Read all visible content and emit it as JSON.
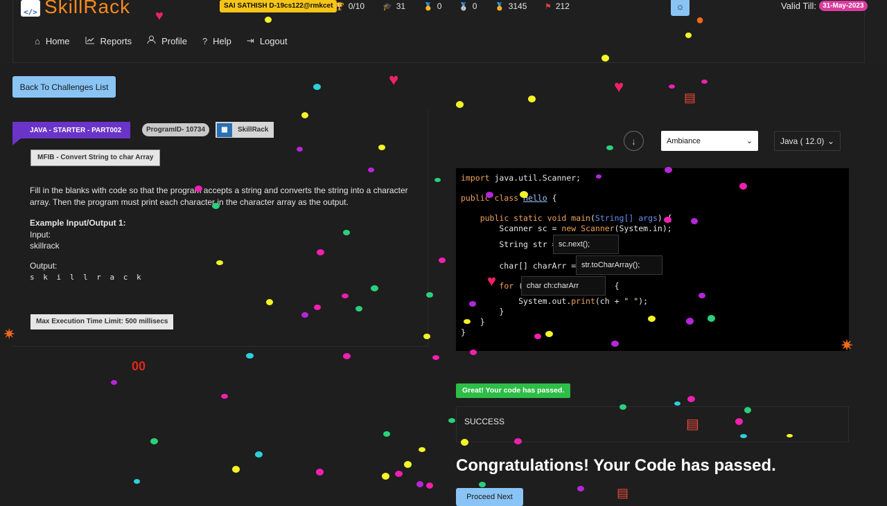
{
  "header": {
    "logo_text": "SkillRack",
    "logo_box": "</>",
    "user": "SAI SATHISH D-19cs122@rmkcet",
    "stats": [
      {
        "icon": "trophy-icon",
        "glyph": "🏆",
        "value": "0/10"
      },
      {
        "icon": "graduation-cap-icon",
        "glyph": "🎓",
        "value": "31"
      },
      {
        "icon": "gold-medal-icon",
        "glyph": "🥇",
        "value": "0"
      },
      {
        "icon": "silver-medal-icon",
        "glyph": "🥈",
        "value": "0"
      },
      {
        "icon": "red-medal-icon",
        "glyph": "🏅",
        "value": "3145"
      },
      {
        "icon": "flag-icon",
        "glyph": "⚑",
        "value": "212"
      }
    ],
    "valid_till_label": "Valid Till:",
    "valid_till_date": "31-May-2023",
    "theme_icon": "sun-icon"
  },
  "menu": {
    "items": [
      {
        "label": "Home",
        "icon": "home-icon",
        "glyph": "⌂"
      },
      {
        "label": "Reports",
        "icon": "chart-icon",
        "glyph": "📈"
      },
      {
        "label": "Profile",
        "icon": "user-icon",
        "glyph": "👤"
      },
      {
        "label": "Help",
        "icon": "question-icon",
        "glyph": "?"
      },
      {
        "label": "Logout",
        "icon": "logout-icon",
        "glyph": "⇥"
      }
    ]
  },
  "back_button": "Back To Challenges List",
  "problem": {
    "course": "JAVA - STARTER - PART002",
    "program_id": "ProgramID- 10734",
    "provider": "SkillRack",
    "title": "MFIB - Convert String to char Array",
    "description": "Fill in the blanks with code so that the program accepts a string and converts the string into a character array. Then the program must print each character in the character array as the output.",
    "example_title": "Example Input/Output 1:",
    "input_label": "Input:",
    "input_value": "skillrack",
    "output_label": "Output:",
    "output_value": "s k i l l r a c k",
    "time_limit": "Max Execution Time Limit: 500 millisecs"
  },
  "editor": {
    "theme_value": "Ambiance",
    "language_value": "Java ( 12.0)",
    "blanks": {
      "blank1": "sc.next();",
      "blank2": "str.toCharArray();",
      "blank3": "char ch:charArr"
    }
  },
  "result": {
    "badge": "Great! Your code has passed.",
    "status": "SUCCESS",
    "congrats": "Congratulations! Your Code has passed.",
    "proceed": "Proceed Next"
  }
}
